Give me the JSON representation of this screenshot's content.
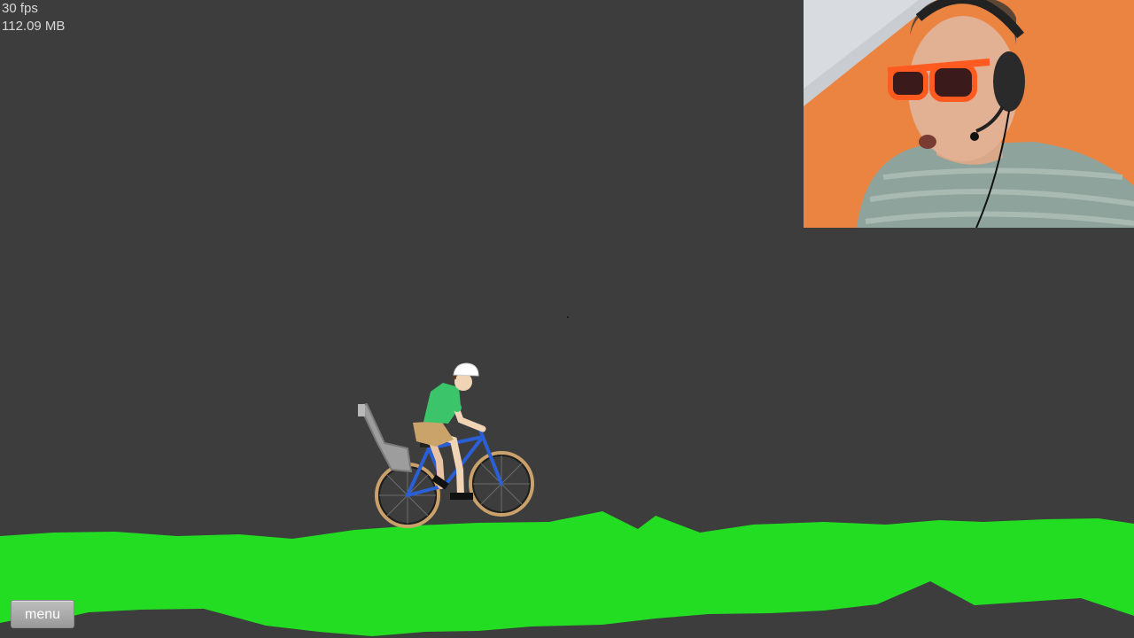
{
  "hud": {
    "fps": "30 fps",
    "memory": "112.09 MB"
  },
  "controls": {
    "menu_label": "menu"
  },
  "colors": {
    "background": "#3d3d3d",
    "ground": "#22dd22",
    "bike_frame": "#2b5fd6",
    "shirt": "#3cc46a",
    "shorts": "#c9a36a",
    "webcam_wall": "#e9803a",
    "sunglasses": "#ff5a1f"
  },
  "vehicle": {
    "type": "bicycle with child seat"
  }
}
